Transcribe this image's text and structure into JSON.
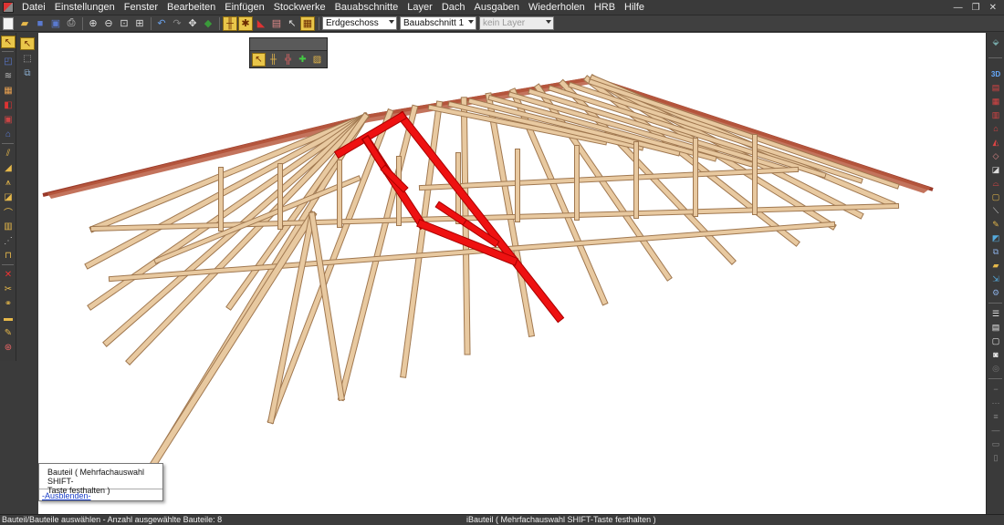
{
  "menu": [
    "Datei",
    "Einstellungen",
    "Fenster",
    "Bearbeiten",
    "Einfügen",
    "Stockwerke",
    "Bauabschnitte",
    "Layer",
    "Dach",
    "Ausgaben",
    "Wiederholen",
    "HRB",
    "Hilfe"
  ],
  "window_controls": {
    "minimize": "—",
    "restore": "❐",
    "close": "✕"
  },
  "toolbar": {
    "icons": [
      "new-file-icon",
      "open-folder-icon",
      "save-icon",
      "save-all-icon",
      "print-icon",
      "zoom-in-icon",
      "zoom-out-icon",
      "zoom-window-icon",
      "zoom-all-icon",
      "undo-icon",
      "redo-icon",
      "pan-icon",
      "3d-cube-icon",
      "truss-icon",
      "truss-alt-icon",
      "roof-icon",
      "section-icon",
      "pointer-icon",
      "layer-icon"
    ],
    "storey_select": "Erdgeschoss",
    "section_select": "Bauabschnitt 1",
    "layer_select": "kein Layer"
  },
  "tooltip": {
    "line1": "Bauteil ( Mehrfachauswahl SHIFT-",
    "line2": "Taste festhalten )",
    "link": "-Ausblenden-"
  },
  "status": {
    "left": "Bauteil/Bauteile auswählen  - Anzahl ausgewählte Bauteile: 8",
    "middle": "iBauteil ( Mehrfachauswahl SHIFT-Taste festhalten )"
  },
  "colors": {
    "timber": "#e8c9a0",
    "timber_edge": "#a07850",
    "selected": "#ee1111",
    "roof_tiles": "#9a3a2a",
    "chrome": "#3a3a3a"
  }
}
